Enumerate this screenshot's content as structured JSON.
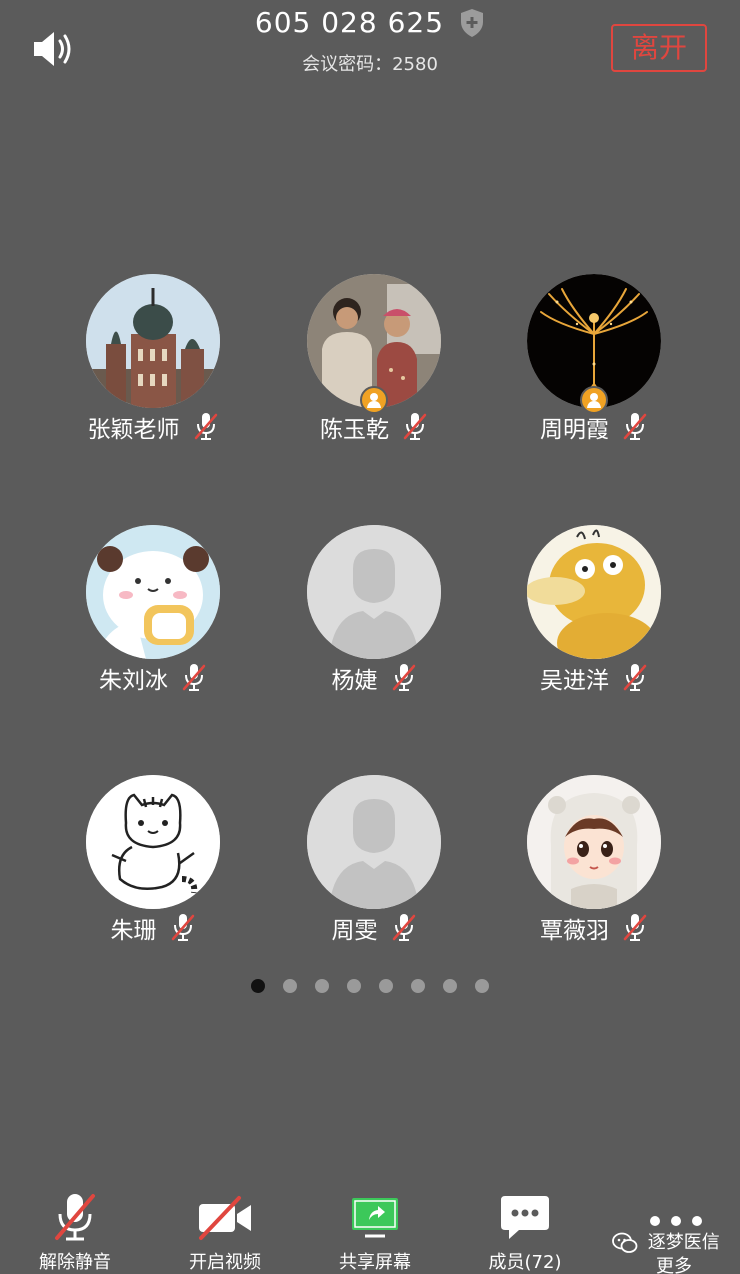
{
  "header": {
    "meeting_id": "605 028 625",
    "password_text": "会议密码：2580",
    "leave_label": "离开"
  },
  "participants": [
    {
      "name": "张颖老师",
      "avatar": "church-photo",
      "host": false,
      "muted": true
    },
    {
      "name": "陈玉乾",
      "avatar": "couple-photo",
      "host": true,
      "muted": true
    },
    {
      "name": "周明霞",
      "avatar": "phoenix-photo",
      "host": true,
      "muted": true
    },
    {
      "name": "朱刘冰",
      "avatar": "panda-cartoon",
      "host": false,
      "muted": true
    },
    {
      "name": "杨婕",
      "avatar": "default-silhouette",
      "host": false,
      "muted": true
    },
    {
      "name": "吴进洋",
      "avatar": "psyduck-cartoon",
      "host": false,
      "muted": true
    },
    {
      "name": "朱珊",
      "avatar": "cat-doodle",
      "host": false,
      "muted": true
    },
    {
      "name": "周雯",
      "avatar": "default-silhouette",
      "host": false,
      "muted": true
    },
    {
      "name": "覃薇羽",
      "avatar": "girl-illustration",
      "host": false,
      "muted": true
    }
  ],
  "pagination": {
    "total_pages": 8,
    "current_page": 1
  },
  "toolbar": {
    "unmute_label": "解除静音",
    "video_label": "开启视频",
    "share_label": "共享屏幕",
    "members_label": "成员(72)",
    "more_label": "更多"
  },
  "watermark": {
    "text": "逐梦医信"
  },
  "colors": {
    "background": "#5b5b5b",
    "leave_red": "#e0463f",
    "mute_red": "#e0463f",
    "share_green": "#3cc85a",
    "host_badge": "#f0a224"
  }
}
